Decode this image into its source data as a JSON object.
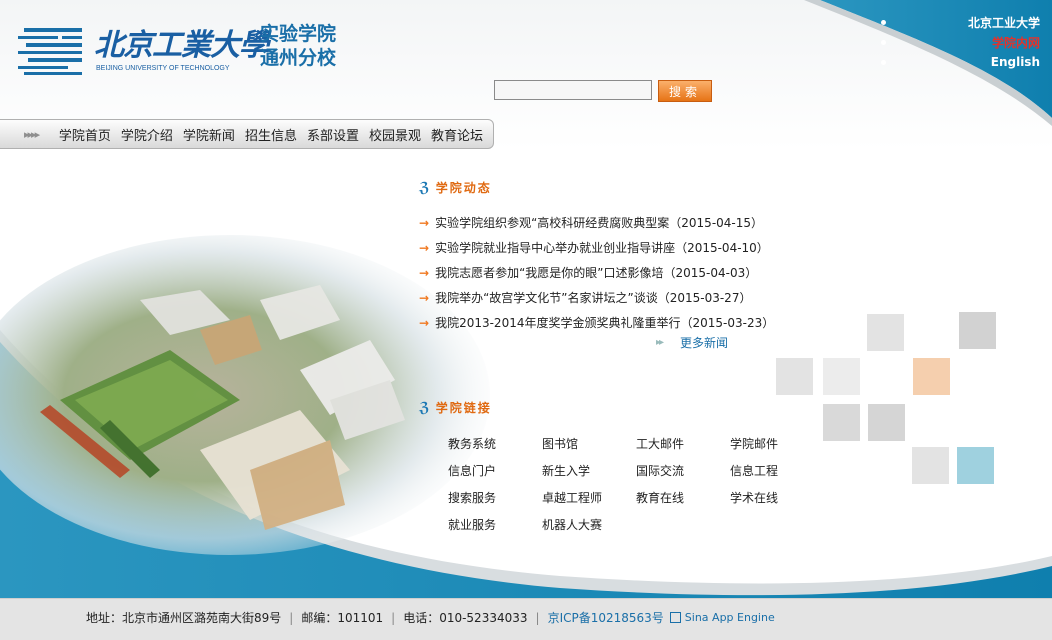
{
  "header": {
    "univ_name_cn": "北京工業大學",
    "univ_name_en": "BEIJING UNIVERSITY OF TECHNOLOGY",
    "college_line1": "实验学院",
    "college_line2": "通州分校"
  },
  "top_links": [
    {
      "label": "北京工业大学"
    },
    {
      "label": "学院内网"
    },
    {
      "label": "English"
    }
  ],
  "search": {
    "value": "",
    "button_label": "搜索"
  },
  "nav": {
    "items": [
      "学院首页",
      "学院介绍",
      "学院新闻",
      "招生信息",
      "系部设置",
      "校园景观",
      "教育论坛"
    ]
  },
  "news": {
    "title": "学院动态",
    "items": [
      "实验学院组织参观“高校科研经费腐败典型案（2015-04-15）",
      "实验学院就业指导中心举办就业创业指导讲座（2015-04-10）",
      "我院志愿者参加“我愿是你的眼”口述影像培（2015-04-03）",
      "我院举办“故宫学文化节”名家讲坛之”谈谈（2015-03-27）",
      "我院2013-2014年度奖学金颁奖典礼隆重举行（2015-03-23）"
    ],
    "more_label": "更多新闻"
  },
  "links": {
    "title": "学院链接",
    "items": [
      "教务系统",
      "图书馆",
      "工大邮件",
      "学院邮件",
      "信息门户",
      "新生入学",
      "国际交流",
      "信息工程",
      "搜索服务",
      "卓越工程师",
      "教育在线",
      "学术在线",
      "就业服务",
      "机器人大赛"
    ]
  },
  "footer": {
    "address": "地址：北京市通州区潞苑南大街89号",
    "postcode": "邮编：101101",
    "phone": "电话：010-52334033",
    "icp": "京ICP备10218563号",
    "sae": "Sina App Engine"
  },
  "colors": {
    "brand_blue": "#1a8ab8",
    "accent_orange": "#f07820",
    "active_link": "#e4322b"
  }
}
